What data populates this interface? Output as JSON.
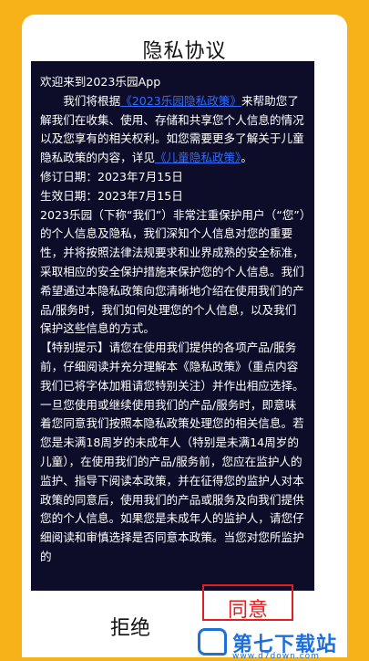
{
  "dialog": {
    "title": "隐私协议"
  },
  "content": {
    "greeting": "欢迎来到2023乐园App",
    "intro_pre": "我们将根据",
    "link_policy": "《2023乐园隐私政策》",
    "intro_post": "来帮助您了解我们在收集、使用、存储和共享您个人信息的情况以及您享有的相关权利。如您需要更多了解关于儿童隐私政策的内容，详见",
    "link_child": "《儿童隐私政策》",
    "intro_end": "。",
    "revised_date": "修订日期：2023年7月15日",
    "effective_date": "生效日期：2023年7月15日",
    "para1": "2023乐园（下称“我们”）非常注重保护用户（“您”）的个人信息及隐私，我们深知个人信息对您的重要性，并将按照法律法规要求和业界成熟的安全标准，采取相应的安全保护措施来保护您的个人信息。我们希望通过本隐私政策向您清晰地介绍在使用我们的产品/服务时，我们如何处理您的个人信息，以及我们保护这些信息的方式。",
    "para2": "【特别提示】请您在使用我们提供的各项产品/服务前，仔细阅读并充分理解本《隐私政策》（重点内容我们已将字体加粗请您特别关注）并作出相应选择。一旦您使用或继续使用我们的产品/服务时，即意味着您同意我们按照本隐私政策处理您的相关信息。若您是未满18周岁的未成年人（特别是未满14周岁的儿童），在使用我们的产品/服务前，您应在监护人的监护、指导下阅读本政策，并在征得您的监护人对本政策的同意后，使用我们的产品或服务及向我们提供您的个人信息。如果您是未成年人的监护人，请您仔细阅读和审慎选择是否同意本政策。当您对您所监护的"
  },
  "buttons": {
    "reject": "拒绝",
    "agree": "同意"
  },
  "watermark": {
    "brand": "第七下载站",
    "url": "www.d7down.com"
  },
  "colors": {
    "background": "#f7b219",
    "content_bg": "#0d0d2a",
    "link": "#2f6bff",
    "highlight_border": "#e02020",
    "watermark": "#1e6fd9"
  }
}
